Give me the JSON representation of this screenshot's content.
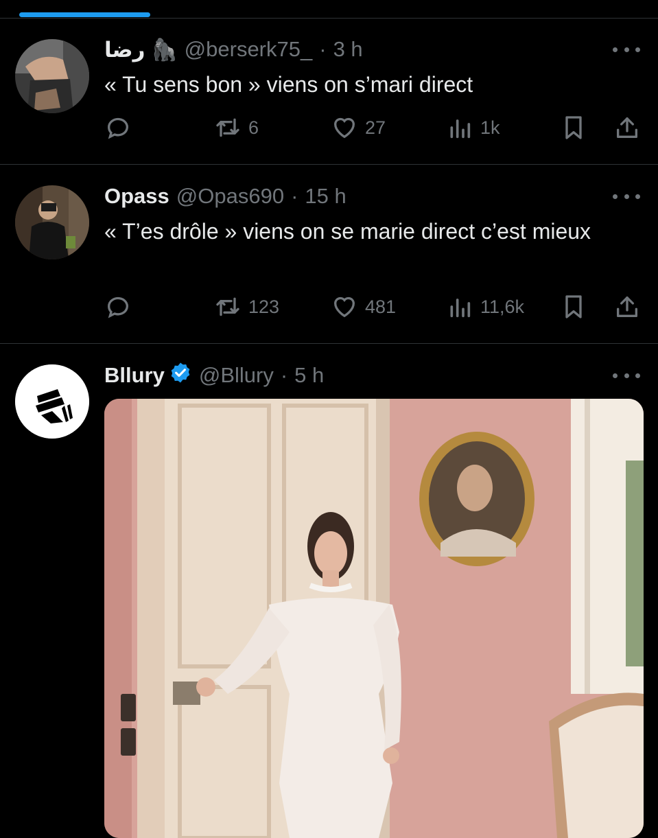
{
  "tweets": [
    {
      "name": "رضا 🦍",
      "handle": "@berserk75_",
      "separator": "·",
      "time": "3 h",
      "text": "« Tu sens bon » viens on s’mari direct",
      "retweets": "6",
      "likes": "27",
      "views": "1k"
    },
    {
      "name": "Opass",
      "handle": "@Opas690",
      "separator": "·",
      "time": "15 h",
      "text": "« T’es drôle » viens on se marie direct c’est mieux",
      "retweets": "123",
      "likes": "481",
      "views": "11,6k"
    },
    {
      "name": "Bllury",
      "handle": "@Bllury",
      "separator": "·",
      "time": "5 h",
      "verified": true
    }
  ],
  "icons": {
    "reply": "reply-icon",
    "retweet": "retweet-icon",
    "like": "heart-icon",
    "views": "views-icon",
    "bookmark": "bookmark-icon",
    "share": "share-icon",
    "more": "more-icon",
    "verified": "verified-badge-icon"
  },
  "colors": {
    "background": "#000000",
    "accent": "#1d9bf0",
    "secondary_text": "#71767b",
    "primary_text": "#e7e9ea",
    "divider": "#2f3336"
  }
}
